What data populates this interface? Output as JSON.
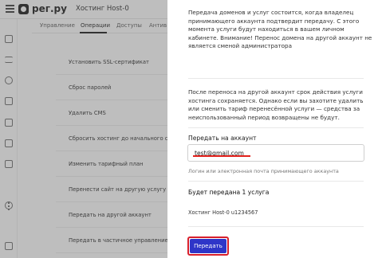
{
  "header": {
    "logo_text": "рег.ру",
    "service_title": "Хостинг Host-0"
  },
  "tabs": [
    "Управление",
    "Операции",
    "Доступы",
    "Антив"
  ],
  "operations": [
    "Установить SSL-сертификат",
    "Сброс паролей",
    "Удалить CMS",
    "Сбросить хостинг до начального состоя",
    "Изменить тарифный план",
    "Перенести сайт на другую услугу хостинга",
    "Передать на другой аккаунт",
    "Передать в частичное управление на другой аккаунт"
  ],
  "drawer": {
    "paragraph1": "Передача доменов и услуг состоится, когда владелец принимающего аккаунта подтвердит передачу. С этого момента услуги будут находиться в вашем личном кабинете. Внимание! Перенос домена на другой аккаунт не является сменой администратора",
    "paragraph2": "После переноса на другой аккаунт срок действия услуги хостинга сохраняется. Однако если вы захотите удалить или сменить тариф перенесённой услуги — средства за неиспользованный период возвращены не будут.",
    "transfer_label": "Передать на аккаунт",
    "account_value": "test@gmail.com",
    "account_hint": "Логин или электронная почта принимающего аккаунта",
    "count_label": "Будет передана 1 услуга",
    "service_item": "Хостинг Host-0 u1234567",
    "submit_label": "Передать"
  },
  "icons": {
    "rail": [
      "home-icon",
      "list-icon",
      "globe-icon",
      "folder-icon",
      "card-icon",
      "server-icon",
      "grid-icon",
      "cloud-icon",
      "flag-icon"
    ]
  },
  "colors": {
    "submit_bg": "#2e35c8",
    "highlight": "#e2211c"
  }
}
